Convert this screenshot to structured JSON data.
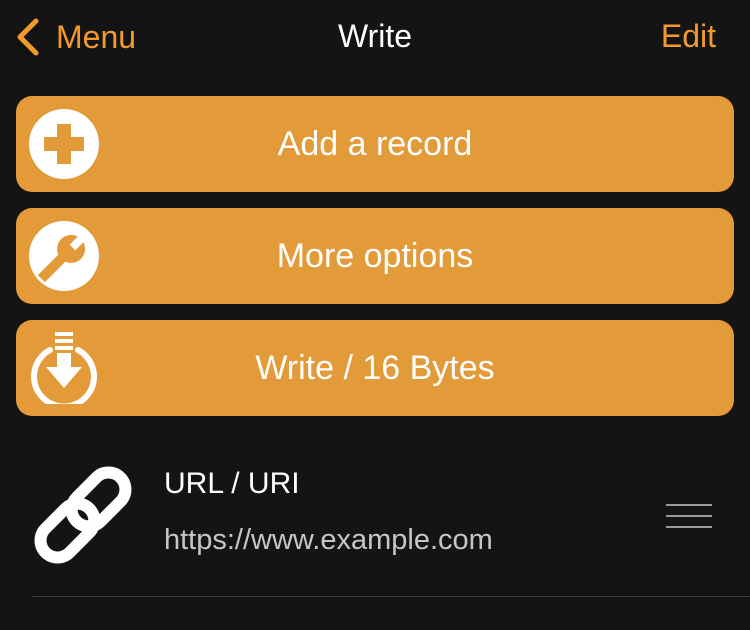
{
  "nav": {
    "back_label": "Menu",
    "title": "Write",
    "edit_label": "Edit"
  },
  "actions": [
    {
      "label": "Add a record",
      "icon": "plus-circle-icon"
    },
    {
      "label": "More options",
      "icon": "wrench-icon"
    },
    {
      "label": "Write / 16 Bytes",
      "icon": "download-circle-icon"
    }
  ],
  "records": [
    {
      "type": "URL / URI",
      "value": "https://www.example.com",
      "icon": "link-icon"
    }
  ],
  "colors": {
    "accent": "#F39A2C",
    "button": "#E39A38",
    "background": "#141414"
  }
}
